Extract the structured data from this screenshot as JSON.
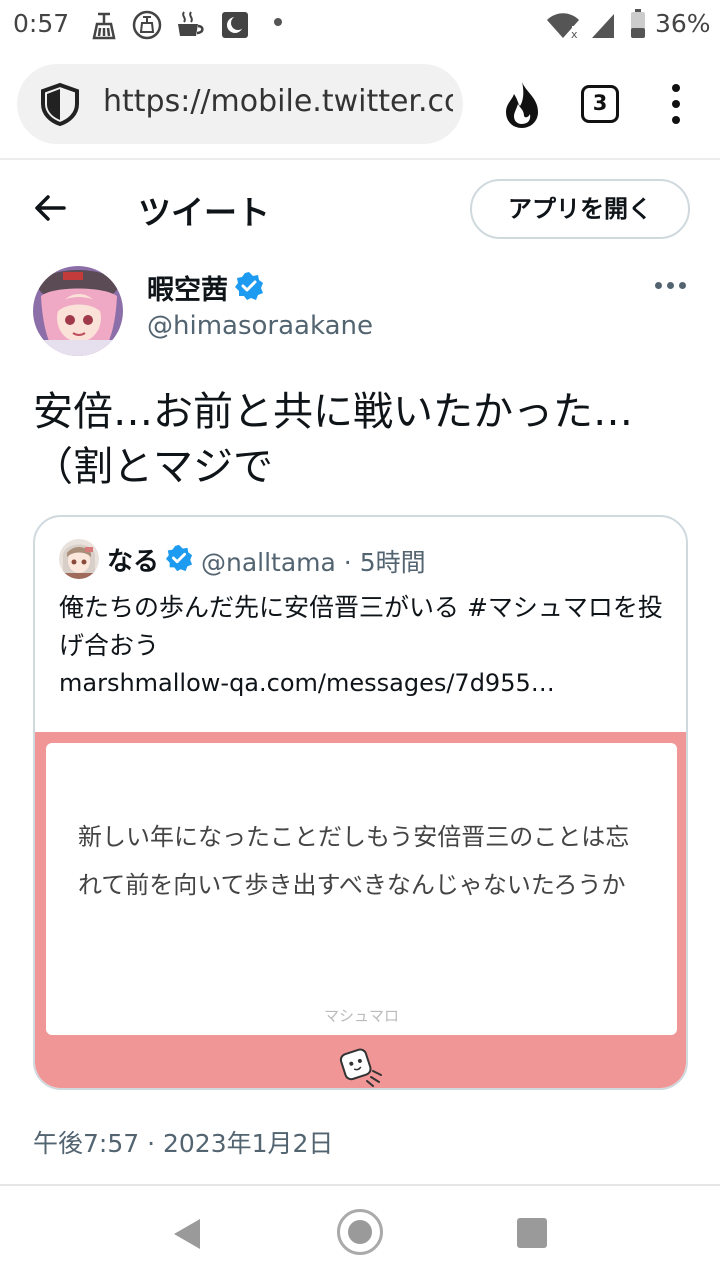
{
  "status_bar": {
    "time": "0:57",
    "battery": "36%",
    "icons": [
      "broom-icon",
      "broom-circle-icon",
      "steam-cup-icon",
      "moon-app-icon",
      "notification-dot-icon",
      "wifi-icon",
      "signal-icon",
      "battery-icon"
    ]
  },
  "browser": {
    "url": "https://mobile.twitter.com/himasoraakane/status",
    "tab_count": "3",
    "icons": [
      "shield-icon",
      "fire-icon",
      "tabs-icon",
      "menu-icon"
    ]
  },
  "header": {
    "title": "ツイート",
    "open_app_label": "アプリを開く"
  },
  "tweet": {
    "author_name": "暇空茜",
    "author_handle": "@himasoraakane",
    "text": "安倍…お前と共に戦いたかった…（割とマジで",
    "timestamp": "午後7:57 · 2023年1月2日"
  },
  "quote": {
    "author_name": "なる",
    "handle_time": "@nalltama · 5時間",
    "text": "俺たちの歩んだ先に安倍晋三がいる #マシュマロを投げ合おう",
    "link": "marshmallow-qa.com/messages/7d955…",
    "marshmallow_text": "新しい年になったことだしもう安倍晋三のことは忘れて前を向いて歩き出すべきなんじゃないたろうか",
    "marshmallow_brand": "マシュマロ"
  },
  "colors": {
    "verified": "#1d9bf0",
    "marshmallow_pink": "#f19697",
    "text": "#0f1419",
    "secondary": "#536471"
  }
}
